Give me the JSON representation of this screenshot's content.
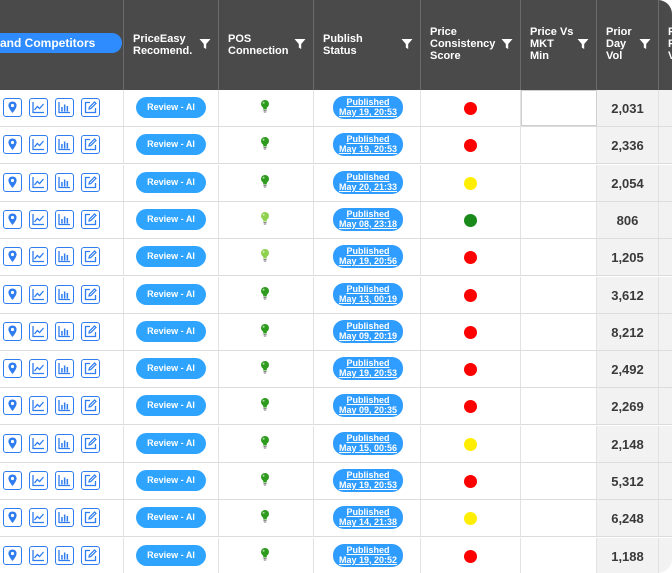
{
  "header": {
    "competitors_label": "and Competitors",
    "columns": [
      {
        "id": "priceeasy",
        "line1": "PriceEasy",
        "line2": "Recomend.",
        "line3": ""
      },
      {
        "id": "pos",
        "line1": "POS",
        "line2": "Connection",
        "line3": ""
      },
      {
        "id": "publish",
        "line1": "Publish",
        "line2": "Status",
        "line3": ""
      },
      {
        "id": "consistency",
        "line1": "Price",
        "line2": "Consistency",
        "line3": "Score"
      },
      {
        "id": "mkt",
        "line1": "Price Vs",
        "line2": "MKT",
        "line3": "Min"
      },
      {
        "id": "vol",
        "line1": "Prior",
        "line2": "Day",
        "line3": "Vol"
      },
      {
        "id": "next",
        "line1": "P",
        "line2": "P",
        "line3": "V"
      }
    ]
  },
  "icon_names": [
    "map-pin-icon",
    "line-chart-icon",
    "bar-chart-icon",
    "edit-icon"
  ],
  "colors": {
    "header_bg": "#4a4a4a",
    "accent_blue": "#2f9cff",
    "status_red": "#ff0000",
    "status_yellow": "#ffee00",
    "status_green": "#1a8a1a",
    "bulb_green": "#2e9b1e",
    "bulb_light": "#8fd14f"
  },
  "rows": [
    {
      "review": "Review - AI",
      "bulb": "green",
      "pub_status": "Published",
      "pub_date": "May 19, 20:53",
      "score": "red",
      "vol": "2,031"
    },
    {
      "review": "Review - AI",
      "bulb": "green",
      "pub_status": "Published",
      "pub_date": "May 19, 20:53",
      "score": "red",
      "vol": "2,336"
    },
    {
      "review": "Review - AI",
      "bulb": "green",
      "pub_status": "Published",
      "pub_date": "May 20, 21:33",
      "score": "yellow",
      "vol": "2,054"
    },
    {
      "review": "Review - AI",
      "bulb": "light",
      "pub_status": "Published",
      "pub_date": "May 08, 23:18",
      "score": "green",
      "vol": "806"
    },
    {
      "review": "Review - AI",
      "bulb": "light",
      "pub_status": "Published",
      "pub_date": "May 19, 20:56",
      "score": "red",
      "vol": "1,205"
    },
    {
      "review": "Review - AI",
      "bulb": "green",
      "pub_status": "Published",
      "pub_date": "May 13, 00:19",
      "score": "red",
      "vol": "3,612"
    },
    {
      "review": "Review - AI",
      "bulb": "green",
      "pub_status": "Published",
      "pub_date": "May 09, 20:19",
      "score": "red",
      "vol": "8,212"
    },
    {
      "review": "Review - AI",
      "bulb": "green",
      "pub_status": "Published",
      "pub_date": "May 19, 20:53",
      "score": "red",
      "vol": "2,492"
    },
    {
      "review": "Review - AI",
      "bulb": "green",
      "pub_status": "Published",
      "pub_date": "May 09, 20:35",
      "score": "red",
      "vol": "2,269"
    },
    {
      "review": "Review - AI",
      "bulb": "green",
      "pub_status": "Published",
      "pub_date": "May 15, 00:56",
      "score": "yellow",
      "vol": "2,148"
    },
    {
      "review": "Review - AI",
      "bulb": "green",
      "pub_status": "Published",
      "pub_date": "May 19, 20:53",
      "score": "red",
      "vol": "5,312"
    },
    {
      "review": "Review - AI",
      "bulb": "green",
      "pub_status": "Published",
      "pub_date": "May 14, 21:38",
      "score": "yellow",
      "vol": "6,248"
    },
    {
      "review": "Review - AI",
      "bulb": "green",
      "pub_status": "Published",
      "pub_date": "May 19, 20:52",
      "score": "red",
      "vol": "1,188"
    }
  ]
}
